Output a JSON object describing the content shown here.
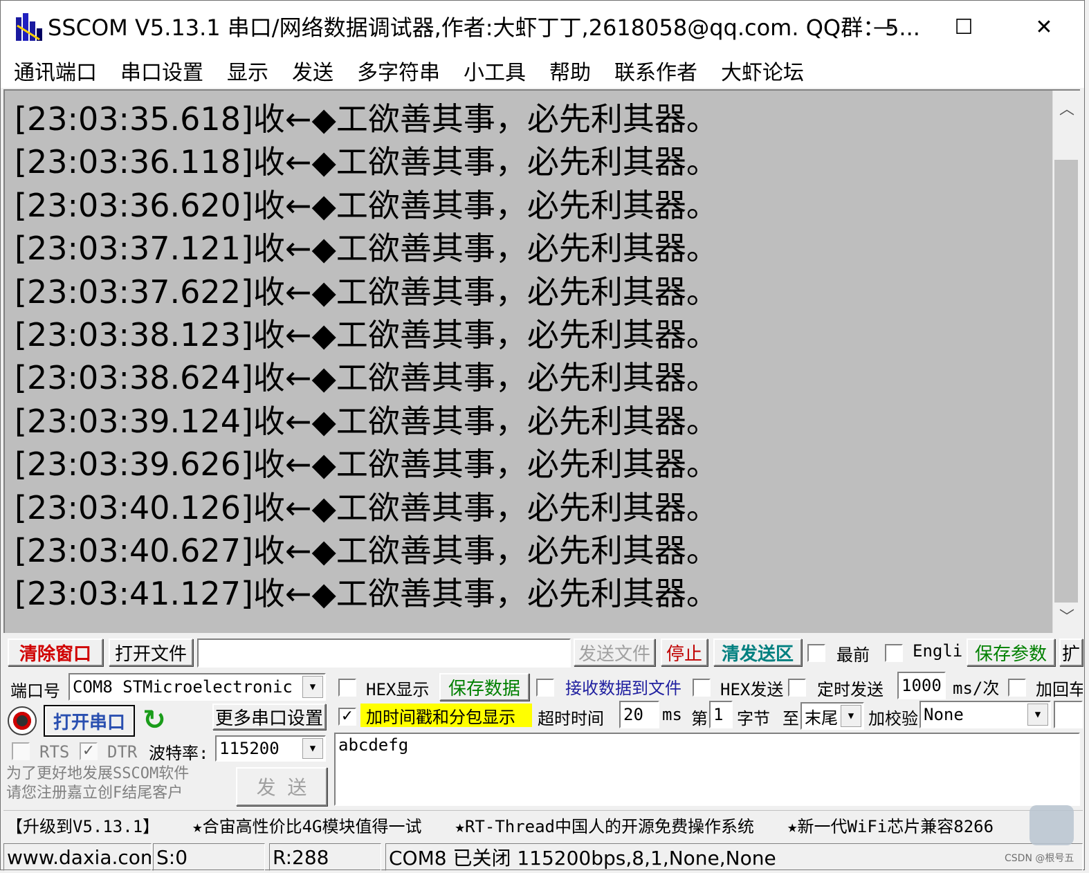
{
  "window": {
    "title": "SSCOM V5.13.1 串口/网络数据调试器,作者:大虾丁丁,2618058@qq.com. QQ群：5...",
    "minimize": "—",
    "maximize": "☐",
    "close": "✕"
  },
  "menu": [
    "通讯端口",
    "串口设置",
    "显示",
    "发送",
    "多字符串",
    "小工具",
    "帮助",
    "联系作者",
    "大虾论坛"
  ],
  "receive": {
    "lines": [
      {
        "time": "[23:03:35.618]",
        "dir": "收←◆",
        "text": "工欲善其事，必先利其器。"
      },
      {
        "time": "[23:03:36.118]",
        "dir": "收←◆",
        "text": "工欲善其事，必先利其器。"
      },
      {
        "time": "[23:03:36.620]",
        "dir": "收←◆",
        "text": "工欲善其事，必先利其器。"
      },
      {
        "time": "[23:03:37.121]",
        "dir": "收←◆",
        "text": "工欲善其事，必先利其器。"
      },
      {
        "time": "[23:03:37.622]",
        "dir": "收←◆",
        "text": "工欲善其事，必先利其器。"
      },
      {
        "time": "[23:03:38.123]",
        "dir": "收←◆",
        "text": "工欲善其事，必先利其器。"
      },
      {
        "time": "[23:03:38.624]",
        "dir": "收←◆",
        "text": "工欲善其事，必先利其器。"
      },
      {
        "time": "[23:03:39.124]",
        "dir": "收←◆",
        "text": "工欲善其事，必先利其器。"
      },
      {
        "time": "[23:03:39.626]",
        "dir": "收←◆",
        "text": "工欲善其事，必先利其器。"
      },
      {
        "time": "[23:03:40.126]",
        "dir": "收←◆",
        "text": "工欲善其事，必先利其器。"
      },
      {
        "time": "[23:03:40.627]",
        "dir": "收←◆",
        "text": "工欲善其事，必先利其器。"
      },
      {
        "time": "[23:03:41.127]",
        "dir": "收←◆",
        "text": "工欲善其事，必先利其器。"
      }
    ]
  },
  "toolbar": {
    "clear_window": "清除窗口",
    "open_file": "打开文件",
    "file_path": "",
    "send_file": "发送文件",
    "stop": "停止",
    "clear_send": "清发送区",
    "topmost_label": "最前",
    "topmost_checked": false,
    "english_label": "Engli",
    "english_checked": false,
    "save_params": "保存参数",
    "expand": "扩"
  },
  "port": {
    "port_label": "端口号",
    "port_value": "COM8 STMicroelectronic",
    "open_port": "打开串口",
    "more_settings": "更多串口设置",
    "rts_label": "RTS",
    "rts_checked": false,
    "dtr_label": "DTR",
    "dtr_checked": true,
    "baud_label": "波特率:",
    "baud_value": "115200",
    "promo_line1": "为了更好地发展SSCOM软件",
    "promo_line2": "请您注册嘉立创F结尾客户",
    "send_button": "发 送"
  },
  "options": {
    "hex_display_label": "HEX显示",
    "hex_display_checked": false,
    "save_data": "保存数据",
    "recv_to_file_checked": false,
    "recv_to_file_label": "接收数据到文件",
    "hex_send_checked": false,
    "hex_send_label": "HEX发送",
    "timed_send_checked": false,
    "timed_send_label": "定时发送",
    "interval_value": "1000",
    "interval_unit": "ms/次",
    "add_crlf_checked": false,
    "add_crlf_label": "加回车",
    "timestamp_checked": true,
    "timestamp_label": "加时间戳和分包显示",
    "timeout_label": "超时时间",
    "timeout_value": "20",
    "timeout_unit": "ms",
    "nth_label": "第",
    "nth_value": "1",
    "byte_label": "字节",
    "to_label": "至",
    "to_value": "末尾",
    "checksum_label": "加校验",
    "checksum_value": "None"
  },
  "send_area": {
    "text": "abcdefg"
  },
  "ticker": [
    "【升级到V5.13.1】",
    "★合宙高性价比4G模块值得一试",
    "★RT-Thread中国人的开源免费操作系统",
    "★新一代WiFi芯片兼容8266"
  ],
  "status": {
    "website": "www.daxia.com",
    "sent": "S:0",
    "received": "R:288",
    "port_status": "COM8 已关闭  115200bps,8,1,None,None"
  },
  "watermark": "CSDN @根号五"
}
